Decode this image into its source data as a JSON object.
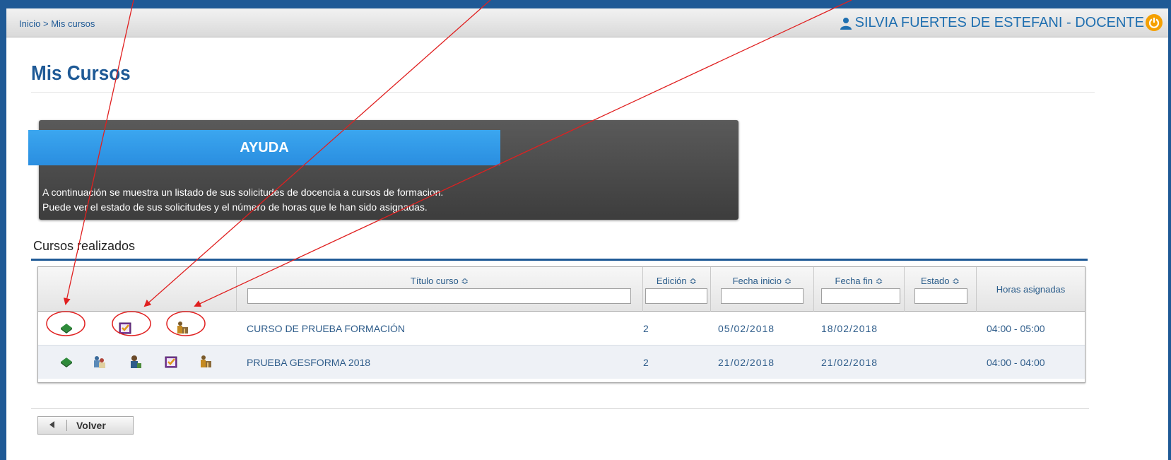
{
  "breadcrumb": {
    "home": "Inicio",
    "separator": ">",
    "current": "Mis cursos"
  },
  "user": {
    "name": "SILVIA FUERTES DE ESTEFANI - DOCENTE"
  },
  "page": {
    "title": "Mis Cursos"
  },
  "help": {
    "title": "AYUDA",
    "line1": "A continuación se muestra un listado de sus solicitudes de docencia a cursos de formacion.",
    "line2": "Puede ver el estado de sus solicitudes y el número de horas que le han sido asignadas."
  },
  "section": {
    "title": "Cursos realizados"
  },
  "table": {
    "columns": {
      "titulo": "Título curso ≎",
      "edicion": "Edición ≎",
      "fecha_inicio": "Fecha inicio ≎",
      "fecha_fin": "Fecha fin ≎",
      "estado": "Estado ≎",
      "horas": "Horas asignadas"
    },
    "rows": [
      {
        "titulo": "CURSO DE PRUEBA FORMACIÓN",
        "edicion": "2",
        "fecha_inicio": "05/02/2018",
        "fecha_fin": "18/02/2018",
        "estado": "",
        "horas": "04:00 - 05:00"
      },
      {
        "titulo": "PRUEBA GESFORMA 2018",
        "edicion": "2",
        "fecha_inicio": "21/02/2018",
        "fecha_fin": "21/02/2018",
        "estado": "",
        "horas": "04:00 - 04:00"
      }
    ]
  },
  "footer": {
    "back_label": "Volver"
  },
  "colors": {
    "accent": "#1f5a96",
    "help_tab": "#2a8ee0",
    "annotation": "#e02020"
  },
  "icons": [
    "green-book-icon",
    "purple-check-icon",
    "teacher-podium-icon",
    "users-icon",
    "person-icon",
    "power-icon",
    "user-icon"
  ]
}
